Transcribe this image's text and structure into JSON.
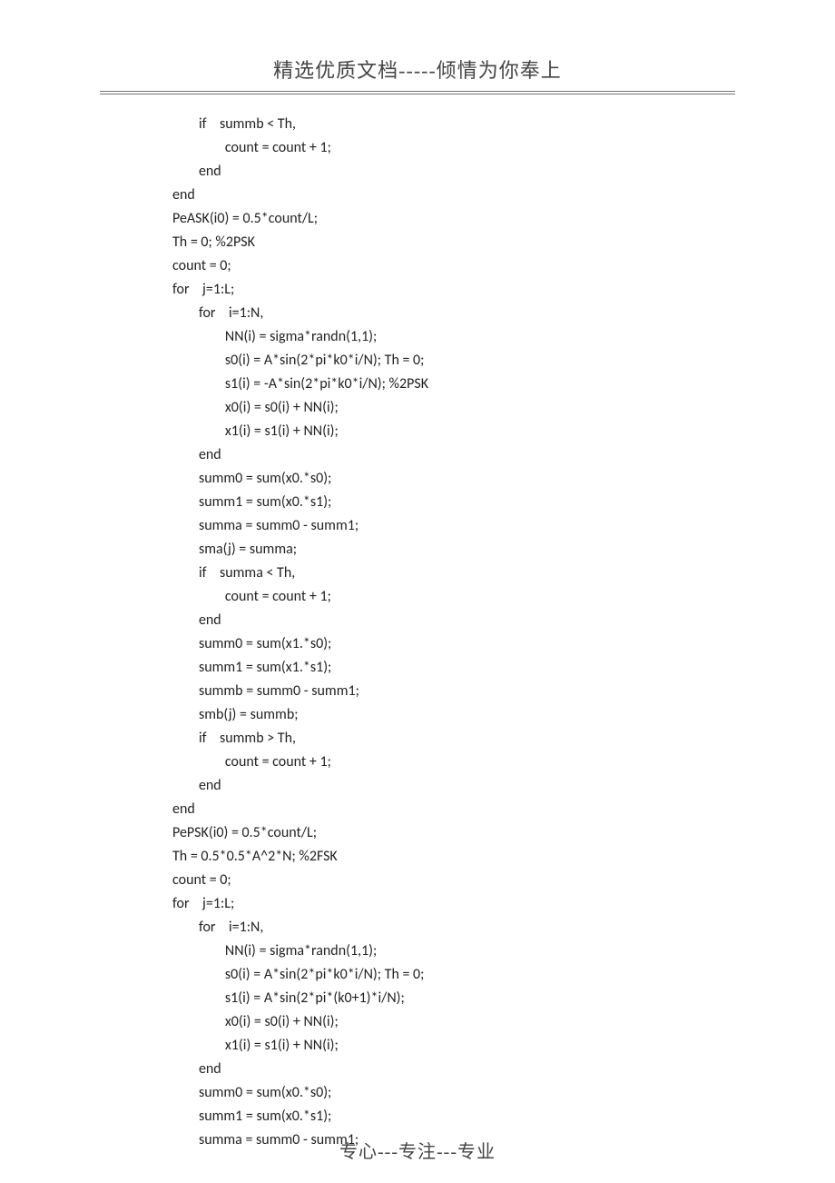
{
  "header": "精选优质文档-----倾情为你奉上",
  "footer": "专心---专注---专业",
  "code": {
    "lines": [
      {
        "indent": 1,
        "text": "if    summb < Th,"
      },
      {
        "indent": 2,
        "text": "count = count + 1;"
      },
      {
        "indent": 1,
        "text": "end"
      },
      {
        "indent": 0,
        "text": "end"
      },
      {
        "indent": 0,
        "text": "PeASK(i0) = 0.5*count/L;"
      },
      {
        "indent": 0,
        "text": "Th = 0; %2PSK"
      },
      {
        "indent": 0,
        "text": "count = 0;"
      },
      {
        "indent": 0,
        "text": "for    j=1:L;"
      },
      {
        "indent": 1,
        "text": "for    i=1:N,"
      },
      {
        "indent": 2,
        "text": "NN(i) = sigma*randn(1,1);"
      },
      {
        "indent": 2,
        "text": "s0(i) = A*sin(2*pi*k0*i/N); Th = 0;"
      },
      {
        "indent": 2,
        "text": "s1(i) = -A*sin(2*pi*k0*i/N); %2PSK"
      },
      {
        "indent": 2,
        "text": "x0(i) = s0(i) + NN(i);"
      },
      {
        "indent": 2,
        "text": "x1(i) = s1(i) + NN(i);"
      },
      {
        "indent": 1,
        "text": "end"
      },
      {
        "indent": 1,
        "text": "summ0 = sum(x0.*s0);"
      },
      {
        "indent": 1,
        "text": "summ1 = sum(x0.*s1);"
      },
      {
        "indent": 1,
        "text": "summa = summ0 - summ1;"
      },
      {
        "indent": 1,
        "text": "sma(j) = summa;"
      },
      {
        "indent": 1,
        "text": "if    summa < Th,"
      },
      {
        "indent": 2,
        "text": "count = count + 1;"
      },
      {
        "indent": 1,
        "text": "end"
      },
      {
        "indent": 1,
        "text": "summ0 = sum(x1.*s0);"
      },
      {
        "indent": 1,
        "text": "summ1 = sum(x1.*s1);"
      },
      {
        "indent": 1,
        "text": "summb = summ0 - summ1;"
      },
      {
        "indent": 1,
        "text": "smb(j) = summb;"
      },
      {
        "indent": 1,
        "text": "if    summb > Th,"
      },
      {
        "indent": 2,
        "text": "count = count + 1;"
      },
      {
        "indent": 1,
        "text": "end"
      },
      {
        "indent": 0,
        "text": "end"
      },
      {
        "indent": 0,
        "text": "PePSK(i0) = 0.5*count/L;"
      },
      {
        "indent": 0,
        "text": "Th = 0.5*0.5*A^2*N; %2FSK"
      },
      {
        "indent": 0,
        "text": "count = 0;"
      },
      {
        "indent": 0,
        "text": "for    j=1:L;"
      },
      {
        "indent": 1,
        "text": "for    i=1:N,"
      },
      {
        "indent": 2,
        "text": "NN(i) = sigma*randn(1,1);"
      },
      {
        "indent": 2,
        "text": "s0(i) = A*sin(2*pi*k0*i/N); Th = 0;"
      },
      {
        "indent": 2,
        "text": "s1(i) = A*sin(2*pi*(k0+1)*i/N);"
      },
      {
        "indent": 2,
        "text": "x0(i) = s0(i) + NN(i);"
      },
      {
        "indent": 2,
        "text": "x1(i) = s1(i) + NN(i);"
      },
      {
        "indent": 1,
        "text": "end"
      },
      {
        "indent": 1,
        "text": "summ0 = sum(x0.*s0);"
      },
      {
        "indent": 1,
        "text": "summ1 = sum(x0.*s1);"
      },
      {
        "indent": 1,
        "text": "summa = summ0 - summ1;"
      }
    ]
  }
}
